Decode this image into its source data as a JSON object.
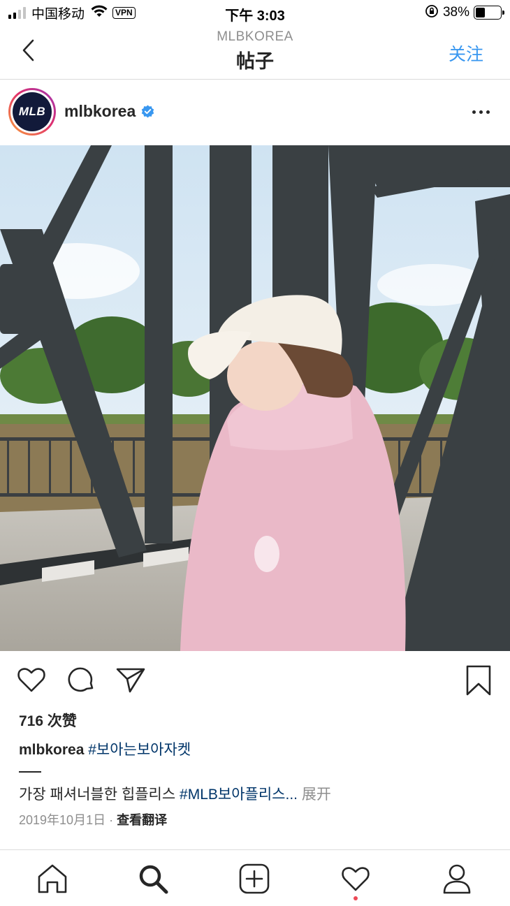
{
  "status_bar": {
    "carrier": "中国移动",
    "vpn": "VPN",
    "time": "下午 3:03",
    "battery_percent": "38%",
    "battery_level": 0.38
  },
  "nav": {
    "subtitle": "MLBKOREA",
    "title": "帖子",
    "follow_label": "关注"
  },
  "post": {
    "avatar_text": "MLB",
    "username": "mlbkorea",
    "verified": true,
    "likes": "716 次赞",
    "caption_user": "mlbkorea",
    "caption_hashtag": "#보아는보아자켓",
    "caption_text": "가장 패셔너블한 힙플리스 ",
    "caption_hashtag2": "#MLB보아플리스...",
    "more_label": " 展开",
    "date": "2019年10月1日",
    "separator": " · ",
    "translate_label": "查看翻译"
  },
  "icons": {
    "back": "chevron-left-icon",
    "more": "more-dots-icon",
    "like": "heart-icon",
    "comment": "comment-icon",
    "share": "send-icon",
    "save": "bookmark-icon",
    "tabs": [
      "home-icon",
      "search-icon",
      "add-post-icon",
      "activity-heart-icon",
      "profile-icon"
    ]
  },
  "colors": {
    "link_blue": "#3897f0",
    "hashtag": "#003569",
    "notification_dot": "#ed4956"
  }
}
